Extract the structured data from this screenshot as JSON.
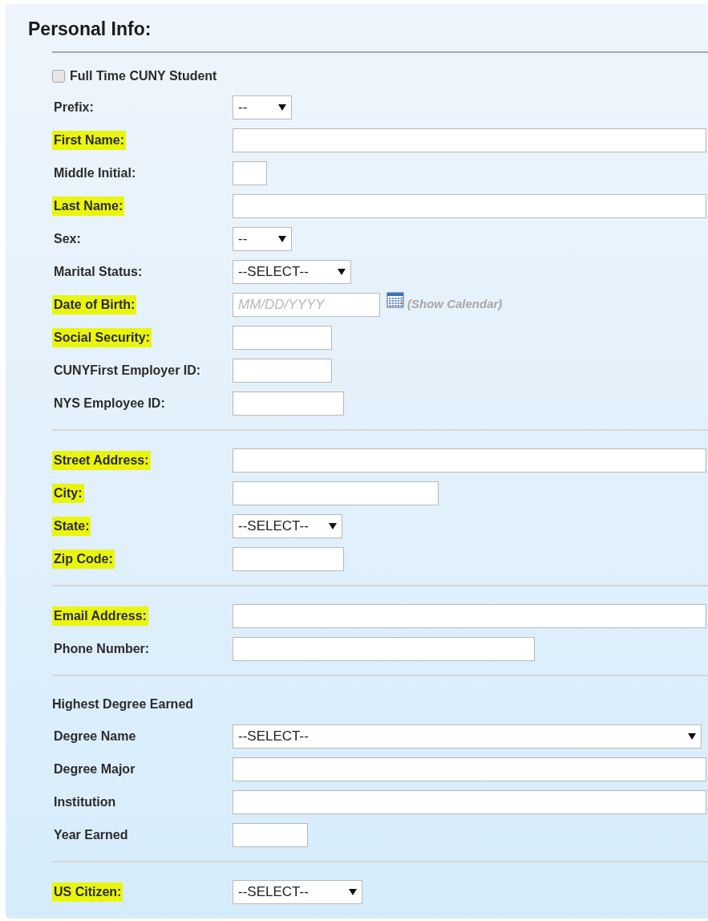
{
  "title": "Personal Info:",
  "sections": [
    {
      "rows": [
        {
          "kind": "checkbox",
          "label": "Full Time CUNY Student",
          "checked": false
        },
        {
          "kind": "select",
          "label": "Prefix:",
          "highlighted": false,
          "value": "--"
        },
        {
          "kind": "input",
          "label": "First Name:",
          "highlighted": true
        },
        {
          "kind": "input",
          "label": "Middle Initial:",
          "highlighted": false
        },
        {
          "kind": "input",
          "label": "Last Name:",
          "highlighted": true
        },
        {
          "kind": "select",
          "label": "Sex:",
          "highlighted": false,
          "value": "--"
        },
        {
          "kind": "select",
          "label": "Marital Status:",
          "highlighted": false,
          "value": "--SELECT--"
        },
        {
          "kind": "date",
          "label": "Date of Birth:",
          "highlighted": true,
          "placeholder": "MM/DD/YYYY",
          "link": "(Show Calendar)"
        },
        {
          "kind": "input",
          "label": "Social Security:",
          "highlighted": true
        },
        {
          "kind": "input",
          "label": "CUNYFirst Employer ID:",
          "highlighted": false
        },
        {
          "kind": "input",
          "label": "NYS Employee ID:",
          "highlighted": false
        }
      ]
    },
    {
      "rows": [
        {
          "kind": "input",
          "label": "Street Address:",
          "highlighted": true
        },
        {
          "kind": "input",
          "label": "City:",
          "highlighted": true
        },
        {
          "kind": "select",
          "label": "State:",
          "highlighted": true,
          "value": "--SELECT--"
        },
        {
          "kind": "input",
          "label": "Zip Code:",
          "highlighted": true
        }
      ]
    },
    {
      "rows": [
        {
          "kind": "input",
          "label": "Email Address:",
          "highlighted": true
        },
        {
          "kind": "input",
          "label": "Phone Number:",
          "highlighted": false
        }
      ]
    },
    {
      "rows": [
        {
          "kind": "heading",
          "label": "Highest Degree Earned"
        },
        {
          "kind": "select",
          "label": "Degree Name",
          "highlighted": false,
          "value": "--SELECT--"
        },
        {
          "kind": "input",
          "label": "Degree Major",
          "highlighted": false
        },
        {
          "kind": "input",
          "label": "Institution",
          "highlighted": false
        },
        {
          "kind": "input",
          "label": "Year Earned",
          "highlighted": false
        }
      ]
    },
    {
      "rows": [
        {
          "kind": "select",
          "label": "US Citizen:",
          "highlighted": true,
          "value": "--SELECT--"
        }
      ]
    }
  ]
}
